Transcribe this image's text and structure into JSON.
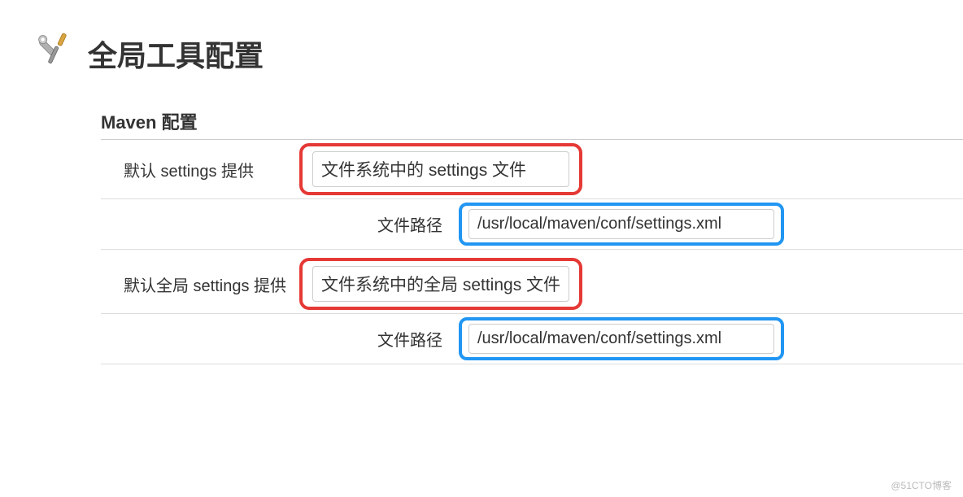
{
  "header": {
    "title": "全局工具配置"
  },
  "section": {
    "maven_title": "Maven 配置"
  },
  "rows": {
    "default_settings_label": "默认 settings 提供",
    "default_settings_select": "文件系统中的 settings 文件",
    "file_path_label": "文件路径",
    "file_path_value": "/usr/local/maven/conf/settings.xml",
    "global_settings_label": "默认全局 settings 提供",
    "global_settings_select": "文件系统中的全局 settings 文件",
    "global_file_path_label": "文件路径",
    "global_file_path_value": "/usr/local/maven/conf/settings.xml"
  },
  "watermark": "@51CTO博客"
}
